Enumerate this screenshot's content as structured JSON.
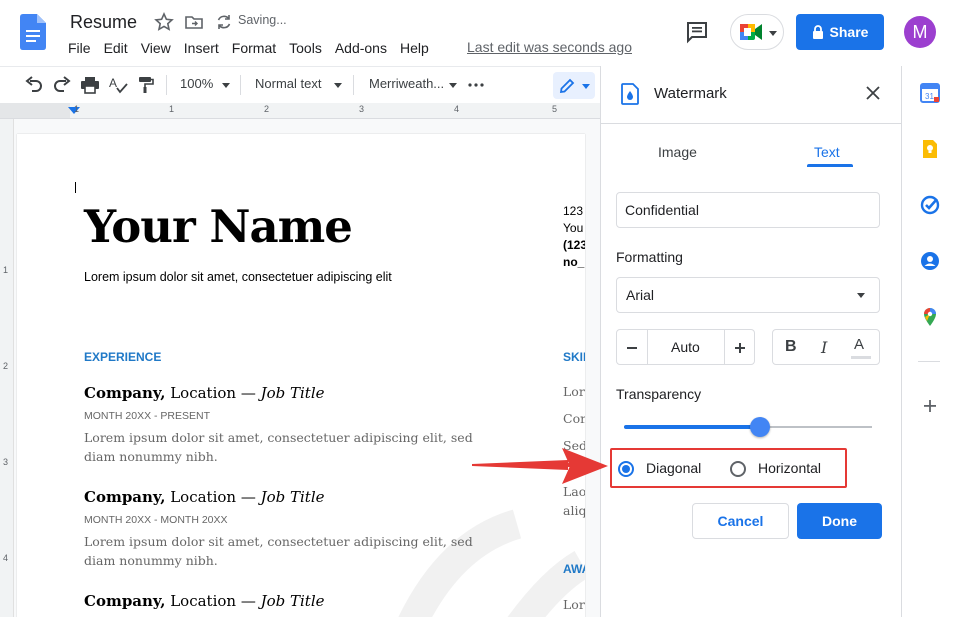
{
  "header": {
    "doc_title": "Resume",
    "saving": "Saving...",
    "menu": [
      "File",
      "Edit",
      "View",
      "Insert",
      "Format",
      "Tools",
      "Add-ons",
      "Help"
    ],
    "last_edit": "Last edit was seconds ago",
    "share_label": "Share",
    "avatar_initial": "M"
  },
  "toolbar": {
    "zoom": "100%",
    "style": "Normal text",
    "font": "Merriweath..."
  },
  "ruler": {
    "numbers": [
      "1",
      "1",
      "2",
      "3",
      "4",
      "5"
    ],
    "vertical_numbers": [
      "1",
      "2",
      "3",
      "4"
    ]
  },
  "document": {
    "name": "Your Name",
    "tagline": "Lorem ipsum dolor sit amet, consectetuer adipiscing elit",
    "experience_heading": "EXPERIENCE",
    "jobs": [
      {
        "company": "Company,",
        "location": " Location — ",
        "title": "Job Title",
        "dates": "MONTH 20XX - PRESENT",
        "desc": "Lorem ipsum dolor sit amet, consectetuer adipiscing elit, sed diam nonummy nibh."
      },
      {
        "company": "Company,",
        "location": " Location — ",
        "title": "Job Title",
        "dates": "MONTH 20XX - MONTH 20XX",
        "desc": "Lorem ipsum dolor sit amet, consectetuer adipiscing elit, sed diam nonummy nibh."
      },
      {
        "company": "Company,",
        "location": " Location — ",
        "title": "Job Title"
      }
    ],
    "side_contact": [
      "123",
      "You",
      "(123",
      "no_"
    ],
    "side_skills_heading": "SKII",
    "side_skills": [
      "Lore",
      "Con",
      "Sed"
    ],
    "side_more": [
      "Lao",
      "aliq"
    ],
    "side_awards_heading": "AWA",
    "side_awards": [
      "Lor"
    ]
  },
  "watermark_panel": {
    "title": "Watermark",
    "tabs": [
      "Image",
      "Text"
    ],
    "active_tab": "Text",
    "text_value": "Confidential",
    "formatting_label": "Formatting",
    "font_value": "Arial",
    "size_value": "Auto",
    "bold_label": "B",
    "italic_label": "I",
    "color_label": "A",
    "transparency_label": "Transparency",
    "transparency_value": 0.55,
    "orientation_options": [
      "Diagonal",
      "Horizontal"
    ],
    "orientation_selected": "Diagonal",
    "cancel_label": "Cancel",
    "done_label": "Done"
  },
  "colors": {
    "accent": "#1a73e8",
    "highlight_box": "#e53935",
    "section_heading": "#2079c7"
  }
}
